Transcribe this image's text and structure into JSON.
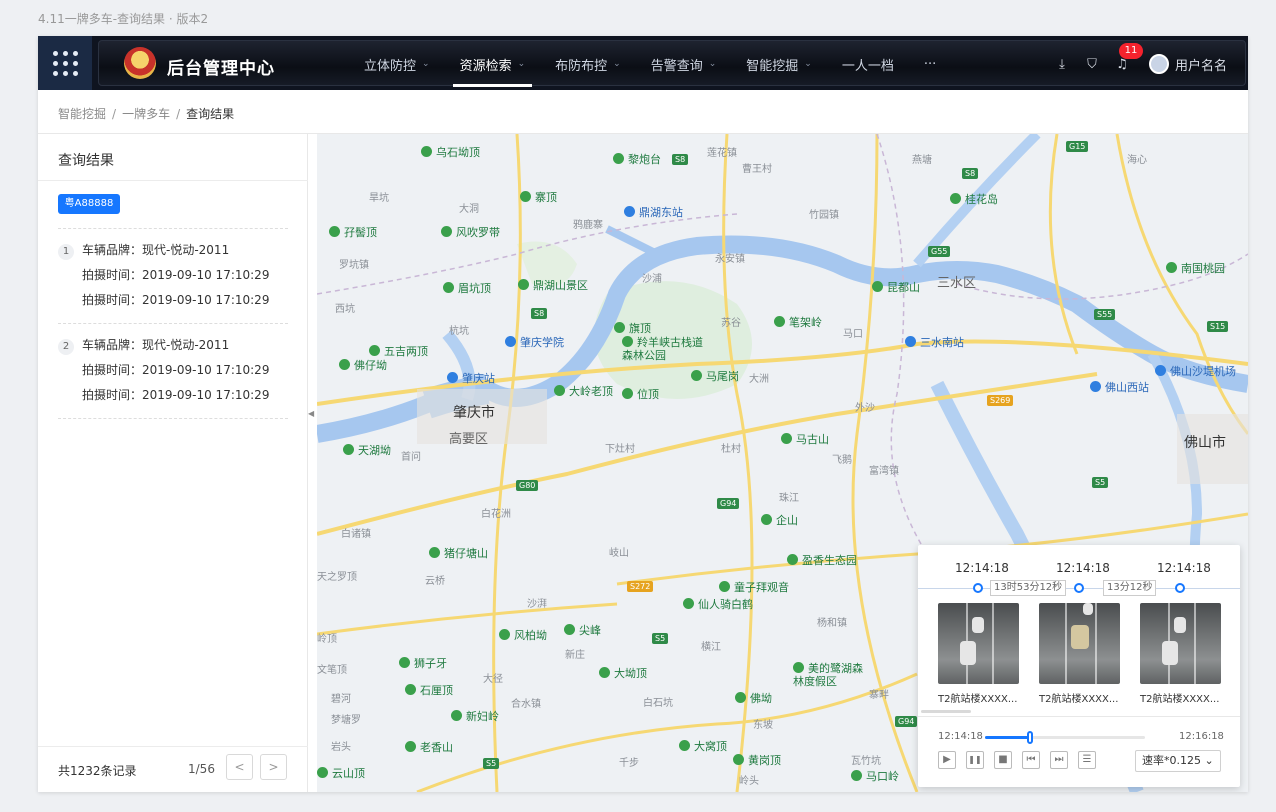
{
  "page_caption": "4.11一牌多车-查询结果 · 版本2",
  "header": {
    "app_title": "后台管理中心",
    "nav": [
      {
        "label": "立体防控",
        "chevron": "⌄"
      },
      {
        "label": "资源检索",
        "chevron": "⌄"
      },
      {
        "label": "布防布控",
        "chevron": "⌄"
      },
      {
        "label": "告警查询",
        "chevron": "⌄"
      },
      {
        "label": "智能挖掘",
        "chevron": "⌄"
      },
      {
        "label": "一人一档",
        "chevron": ""
      },
      {
        "label": "···",
        "chevron": ""
      }
    ],
    "active_nav": "资源检索",
    "notification_count": "11",
    "user_name": "用户名名"
  },
  "breadcrumb": {
    "items": [
      "智能挖掘",
      "一牌多车",
      "查询结果"
    ],
    "separator": "/"
  },
  "results": {
    "title": "查询结果",
    "plate": "粤A88888",
    "records": [
      {
        "index": "1",
        "brand": "车辆品牌：现代-悦动-2011",
        "time1": "拍摄时间：2019-09-10 17:10:29",
        "time2": "拍摄时间：2019-09-10 17:10:29"
      },
      {
        "index": "2",
        "brand": "车辆品牌：现代-悦动-2011",
        "time1": "拍摄时间：2019-09-10 17:10:29",
        "time2": "拍摄时间：2019-09-10 17:10:29"
      }
    ],
    "total": "共1232条记录",
    "page": "1/56",
    "prev": "<",
    "next": ">"
  },
  "map": {
    "labels": {
      "zhaoqing": "肇庆市",
      "gaoyao": "高要区",
      "foshan": "佛山市",
      "sanshui": "三水区",
      "wushidong": "乌石坳顶",
      "liguotai": "黎炮台",
      "fujiao": "孖髻顶",
      "fengchui": "风吹罗带",
      "sandingshan": "鼎湖山景区",
      "zhaoqingxueyuan": "肇庆学院",
      "dinghudongzhan": "鼎湖东站",
      "wugushan": "五吉两顶",
      "fojikeng": "佛仔坳",
      "zhaoqingzhan": "肇庆站",
      "daling": "大岭老顶",
      "wei": "位顶",
      "maweigang": "马尾岗",
      "majigu": "笔架岭",
      "qiding": "旗顶",
      "qiyang": "羚羊峡古栈道森林公园",
      "tianhu": "天湖坳",
      "magushan": "马古山",
      "qishan": "企山",
      "yingxiang": "盈香生态园",
      "kunshan": "昆都山",
      "sanshuinan": "三水南站",
      "guihua": "桂花岛",
      "nanguo": "南国桃园",
      "foshanxizhan": "佛山西站",
      "shadi": "佛山沙堤机场",
      "zhuzaitang": "猪仔塘山",
      "tongzi": "童子拜观音",
      "xianren": "仙人骑白鹤",
      "fengbai": "风柏坳",
      "jianfeng": "尖峰",
      "shizi": "狮子牙",
      "shibei": "石厘顶",
      "xinfuling": "新妇岭",
      "laoxiang": "老香山",
      "yunshan": "云山顶",
      "dawoding": "大坳顶",
      "dawan": "大窝顶",
      "huanggang": "黄岗顶",
      "meidehu": "美的鹭湖森林度假区",
      "fodi": "佛坳",
      "makou": "马口岭",
      "huangtang": "鸦鹿寨",
      "tianzhi": "天之罗顶",
      "wenbi": "文笔顶",
      "jiding": "岭顶",
      "zhaixiang": "寨顶",
      "meidiankeng": "眉坑顶"
    },
    "towns": {
      "shangang": "旱坑",
      "dadong": "大洞",
      "diyou": "莲花镇",
      "baiwangcun": "曹王村",
      "shuzhu": "竹园镇",
      "luokeng": "罗坑镇",
      "xikeng": "西坑",
      "hangkeng": "杭坑",
      "yongan": "永安镇",
      "shagou": "沙浦",
      "suguo": "苏谷",
      "jiangkou": "马口",
      "dajiang": "大洲",
      "waisha": "外沙",
      "shoufu": "首问",
      "xiachou": "下灶村",
      "ducun": "杜村",
      "feiyang": "飞鹅",
      "fuwan": "富湾镇",
      "zhujiang": "珠江",
      "baihuazhou": "白花洲",
      "baizhu": "白诸镇",
      "qiushan": "岐山",
      "yunqiao": "云桥",
      "shapai": "沙湃",
      "xinzhuang": "新庄",
      "hengjiang": "横江",
      "dajing": "大径",
      "heshui": "合水镇",
      "baishi": "白石坑",
      "dongxi": "东坡",
      "yangliu": "杨和镇",
      "qianshui": "千步",
      "linghou": "岭头",
      "yantou": "岩头",
      "jixiang": "吉庄",
      "pengzhang": "碧河",
      "mengzhong": "梦塘罗",
      "wuyin": "瓦竹坑",
      "zhaixi": "寨畔",
      "huanyu": "海心",
      "wangjiao": "燕塘"
    },
    "shields": [
      "S8",
      "S8",
      "G55",
      "S55",
      "S15",
      "S5",
      "S269",
      "G80",
      "G94",
      "G94",
      "S5",
      "S272",
      "S5",
      "G15",
      "S8"
    ]
  },
  "player": {
    "times": [
      "12:14:18",
      "12:14:18",
      "12:14:18"
    ],
    "gaps": [
      "13时53分12秒",
      "13分12秒"
    ],
    "captions": [
      "T2航站楼XXXX...",
      "T2航站楼XXXX...",
      "T2航站楼XXXX..."
    ],
    "start_time": "12:14:18",
    "end_time": "12:16:18",
    "progress": 0.28,
    "speed": "速率*0.125 ⌄",
    "controls": [
      "▶",
      "❚❚",
      "■",
      "⏮",
      "⏭",
      "☰"
    ]
  }
}
